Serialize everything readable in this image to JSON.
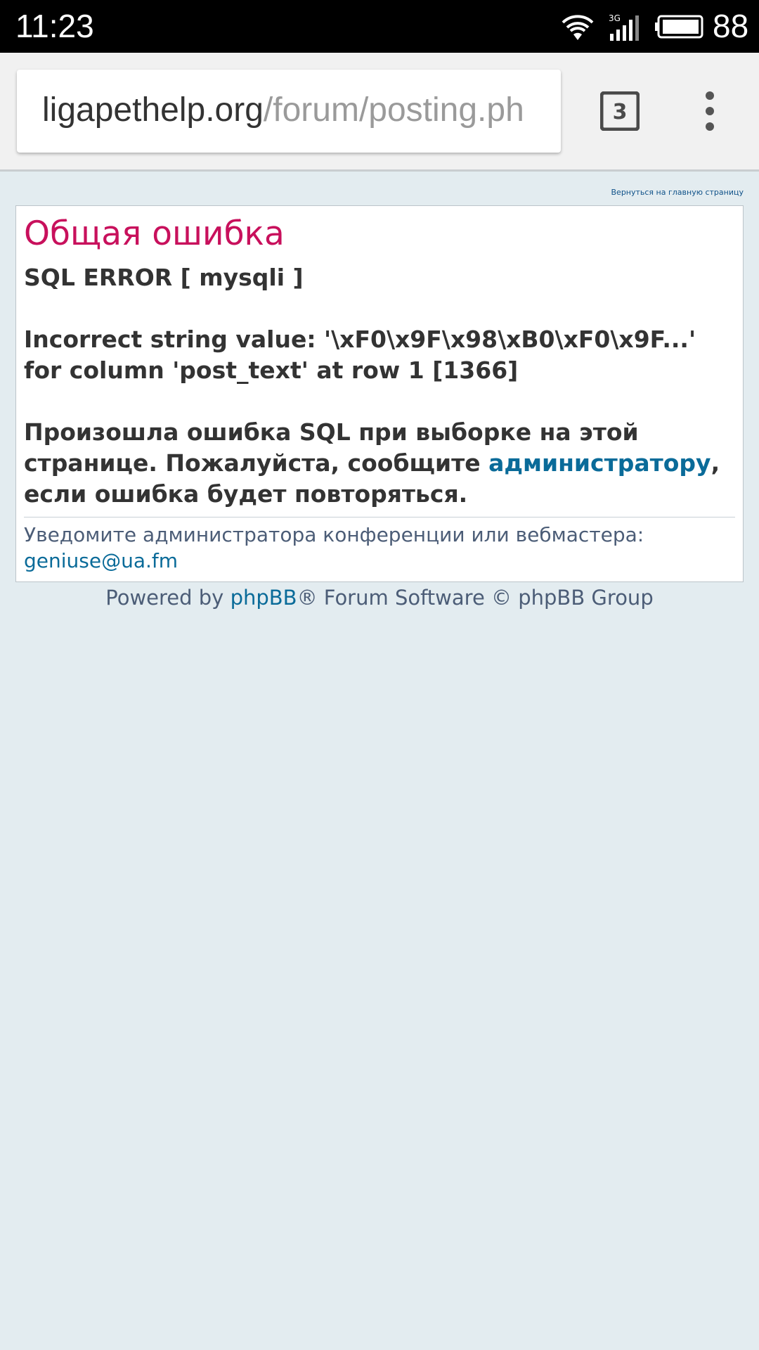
{
  "status_bar": {
    "time": "11:23",
    "network": "3G",
    "battery": "88"
  },
  "browser": {
    "url_domain": "ligapethelp.org",
    "url_path": "/forum/posting.ph",
    "tab_count": "3"
  },
  "page": {
    "back_link": "Вернуться на главную страницу",
    "error_title": "Общая ошибка",
    "sql_error": "SQL ERROR [ mysqli ]",
    "error_detail": "Incorrect string value: '\\xF0\\x9F\\x98\\xB0\\xF0\\x9F...' for column 'post_text' at row 1 [1366]",
    "message_before": "Произошла ошибка SQL при выборке на этой странице. Пожалуйста, сообщите ",
    "message_link": "администратору",
    "message_after": ", если ошибка будет повторяться.",
    "notify_text": "Уведомите администратора конференции или вебмастера:",
    "notify_email": "geniuse@ua.fm",
    "footer_before": "Powered by ",
    "footer_link": "phpBB",
    "footer_after": "® Forum Software © phpBB Group"
  },
  "colors": {
    "title": "#c8105c",
    "link": "#0a6b99",
    "page_bg": "#e3ecf0"
  }
}
